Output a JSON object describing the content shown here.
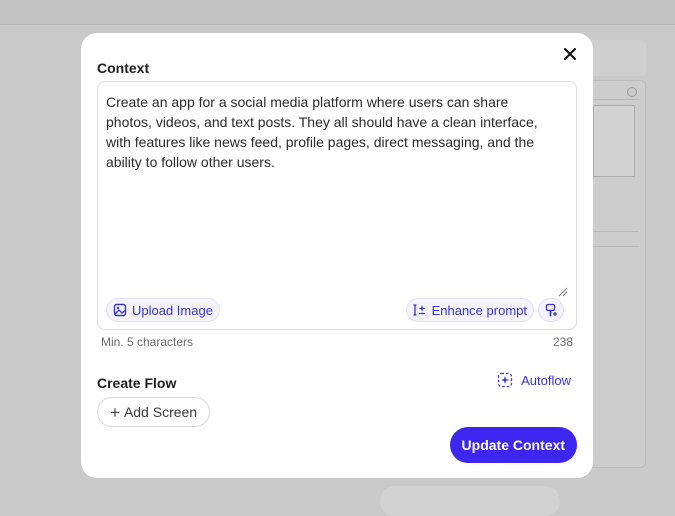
{
  "modal": {
    "context_title": "Context",
    "context_text": "Create an app for a social media platform where users can share photos, videos, and text posts. They all should have a clean interface, with features like news feed, profile pages, direct messaging, and the ability to follow other users.",
    "upload_label": "Upload Image",
    "enhance_label": "Enhance prompt",
    "helper_min": "Min. 5 characters",
    "char_count": "238",
    "flow_title": "Create Flow",
    "autoflow_label": "Autoflow",
    "add_screen_label": "Add Screen",
    "update_label": "Update Context"
  },
  "colors": {
    "accent": "#3d26f0",
    "accent_text": "#3b35c9",
    "backdrop": "#c9c9c9"
  },
  "icons": {
    "close": "close-icon",
    "upload": "image-icon",
    "enhance": "sparkle-text-icon",
    "brush": "brush-icon",
    "autoflow": "autoflow-icon",
    "add": "plus-icon"
  }
}
